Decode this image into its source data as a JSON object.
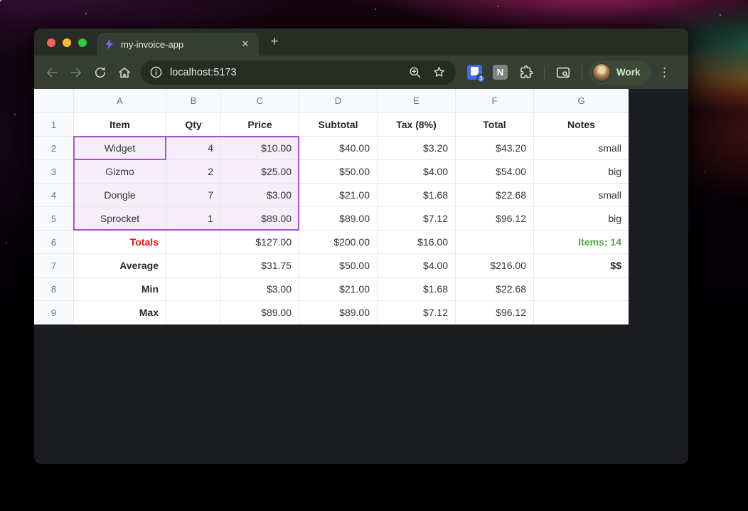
{
  "window": {
    "tab_title": "my-invoice-app",
    "tab_close": "✕",
    "new_tab": "+",
    "url": "localhost:5173",
    "profile_label": "Work",
    "extension_badge_count": "3",
    "notion_initial": "N",
    "menu_dots": "⋮"
  },
  "sheet": {
    "column_headers": [
      "A",
      "B",
      "C",
      "D",
      "E",
      "F",
      "G"
    ],
    "header_row": [
      "Item",
      "Qty",
      "Price",
      "Subtotal",
      "Tax (8%)",
      "Total",
      "Notes"
    ],
    "data_rows": [
      [
        "Widget",
        "4",
        "$10.00",
        "$40.00",
        "$3.20",
        "$43.20",
        "small"
      ],
      [
        "Gizmo",
        "2",
        "$25.00",
        "$50.00",
        "$4.00",
        "$54.00",
        "big"
      ],
      [
        "Dongle",
        "7",
        "$3.00",
        "$21.00",
        "$1.68",
        "$22.68",
        "small"
      ],
      [
        "Sprocket",
        "1",
        "$89.00",
        "$89.00",
        "$7.12",
        "$96.12",
        "big"
      ],
      [
        "Totals",
        "",
        "$127.00",
        "$200.00",
        "$16.00",
        "",
        "Items: 14"
      ],
      [
        "Average",
        "",
        "$31.75",
        "$50.00",
        "$4.00",
        "$216.00",
        "$$"
      ],
      [
        "Min",
        "",
        "$3.00",
        "$21.00",
        "$1.68",
        "$22.68",
        ""
      ],
      [
        "Max",
        "",
        "$89.00",
        "$89.00",
        "$7.12",
        "$96.12",
        ""
      ]
    ],
    "cell_styles": {
      "A2": "center",
      "A3": "center",
      "A4": "center",
      "A5": "center",
      "A6": "label red",
      "A7": "label",
      "A8": "label",
      "A9": "label",
      "G6": "green",
      "G7": "boldc"
    },
    "selection": {
      "range": "A2:C5",
      "active_cell": "A2"
    },
    "colors": {
      "selection_border": "#a751d3",
      "selection_fill": "#f7eefb",
      "totals_red": "#e8141c",
      "items_green": "#54a553"
    }
  }
}
